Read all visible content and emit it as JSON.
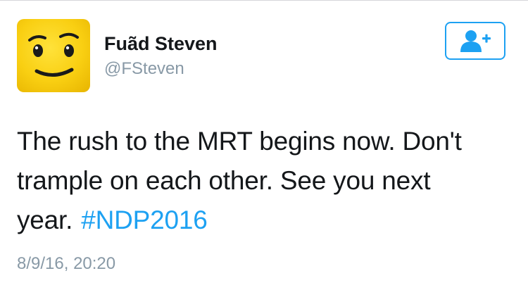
{
  "user": {
    "display_name": "Fuãd Steven",
    "handle": "@FSteven",
    "avatar_icon": "lego-face-avatar"
  },
  "follow_button": {
    "icon": "add-user-icon",
    "color": "#1da1f2"
  },
  "tweet": {
    "lines": [
      "The rush to the MRT begins now. Don't",
      "trample on each other. See you next",
      "year."
    ],
    "hashtag": "#NDP2016",
    "timestamp": "8/9/16, 20:20"
  },
  "colors": {
    "link": "#1da1f2",
    "secondary_text": "#8899a6",
    "primary_text": "#14171a",
    "avatar_yellow": "#f9cf12"
  }
}
